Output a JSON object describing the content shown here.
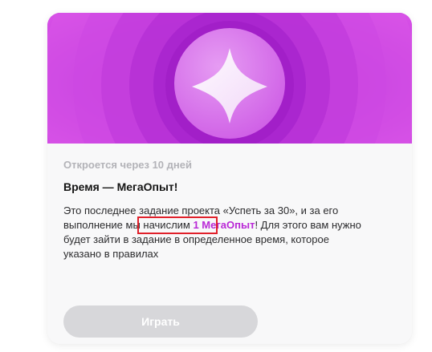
{
  "card": {
    "opens_in": "Откроется через 10 дней",
    "title": "Время — МегаОпыт!",
    "description": {
      "line1": "Это последнее задание проекта «Успеть за 30», и за его",
      "line2_before": "выполнение мы начислим ",
      "reward": "1 МегаОпыт",
      "line2_after": "! Для этого вам нужно",
      "line3": "будет зайти в задание в определенное время, которое",
      "line4": "указано в правилах"
    },
    "play_button_label": "Играть",
    "badge_icon": "sparkle-star-icon"
  },
  "colors": {
    "hero_background": "#c33fe0",
    "reward_accent": "#b928d6",
    "button_disabled": "#d7d7da",
    "highlight_border": "#e0202a"
  }
}
